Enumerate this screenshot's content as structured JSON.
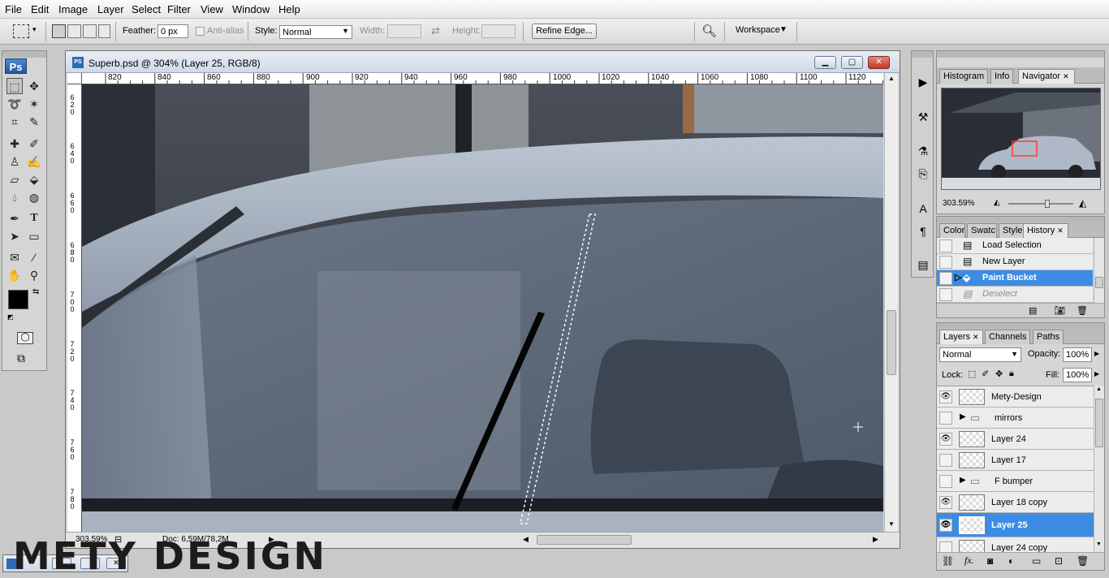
{
  "menu": [
    "File",
    "Edit",
    "Image",
    "Layer",
    "Select",
    "Filter",
    "View",
    "Window",
    "Help"
  ],
  "options": {
    "feather_label": "Feather:",
    "feather_value": "0 px",
    "antialias_label": "Anti-alias",
    "style_label": "Style:",
    "style_value": "Normal",
    "width_label": "Width:",
    "height_label": "Height:",
    "refine_edge": "Refine Edge...",
    "workspace": "Workspace"
  },
  "toolbox": {
    "logo": "Ps"
  },
  "document": {
    "title": "Superb.psd @ 304% (Layer 25, RGB/8)",
    "ruler_h": [
      "820",
      "840",
      "860",
      "880",
      "900",
      "920",
      "940",
      "960",
      "980",
      "1000",
      "1020",
      "1040",
      "1060",
      "1080",
      "1100",
      "1120"
    ],
    "ruler_v": [
      "6\n2\n0",
      "6\n4\n0",
      "6\n6\n0",
      "6\n8\n0",
      "7\n0\n0",
      "7\n2\n0",
      "7\n4\n0",
      "7\n6\n0",
      "7\n8\n0"
    ],
    "zoom": "303,59%",
    "doc_size": "Doc: 6,59M/78,2M"
  },
  "navigator": {
    "tabs": [
      "Histogram",
      "Info",
      "Navigator"
    ],
    "zoom": "303.59%"
  },
  "history": {
    "tabs": [
      "Color",
      "Swatc",
      "Styles",
      "History"
    ],
    "items": [
      {
        "label": "Load Selection",
        "state": "normal"
      },
      {
        "label": "New Layer",
        "state": "normal"
      },
      {
        "label": "Paint Bucket",
        "state": "selected"
      },
      {
        "label": "Deselect",
        "state": "undone"
      }
    ]
  },
  "layers": {
    "tabs": [
      "Layers",
      "Channels",
      "Paths"
    ],
    "blend_mode": "Normal",
    "opacity_label": "Opacity:",
    "opacity_value": "100%",
    "lock_label": "Lock:",
    "fill_label": "Fill:",
    "fill_value": "100%",
    "items": [
      {
        "name": "Mety-Design",
        "visible": true,
        "group": false,
        "selected": false
      },
      {
        "name": "mirrors",
        "visible": false,
        "group": true,
        "selected": false
      },
      {
        "name": "Layer 24",
        "visible": true,
        "group": false,
        "selected": false
      },
      {
        "name": "Layer 17",
        "visible": false,
        "group": false,
        "selected": false
      },
      {
        "name": "F bumper",
        "visible": false,
        "group": true,
        "selected": false
      },
      {
        "name": "Layer 18 copy",
        "visible": true,
        "group": false,
        "selected": false
      },
      {
        "name": "Layer 25",
        "visible": true,
        "group": false,
        "selected": true
      },
      {
        "name": "Layer 24 copy",
        "visible": false,
        "group": false,
        "selected": false
      }
    ]
  },
  "watermark": "METY DESIGN"
}
